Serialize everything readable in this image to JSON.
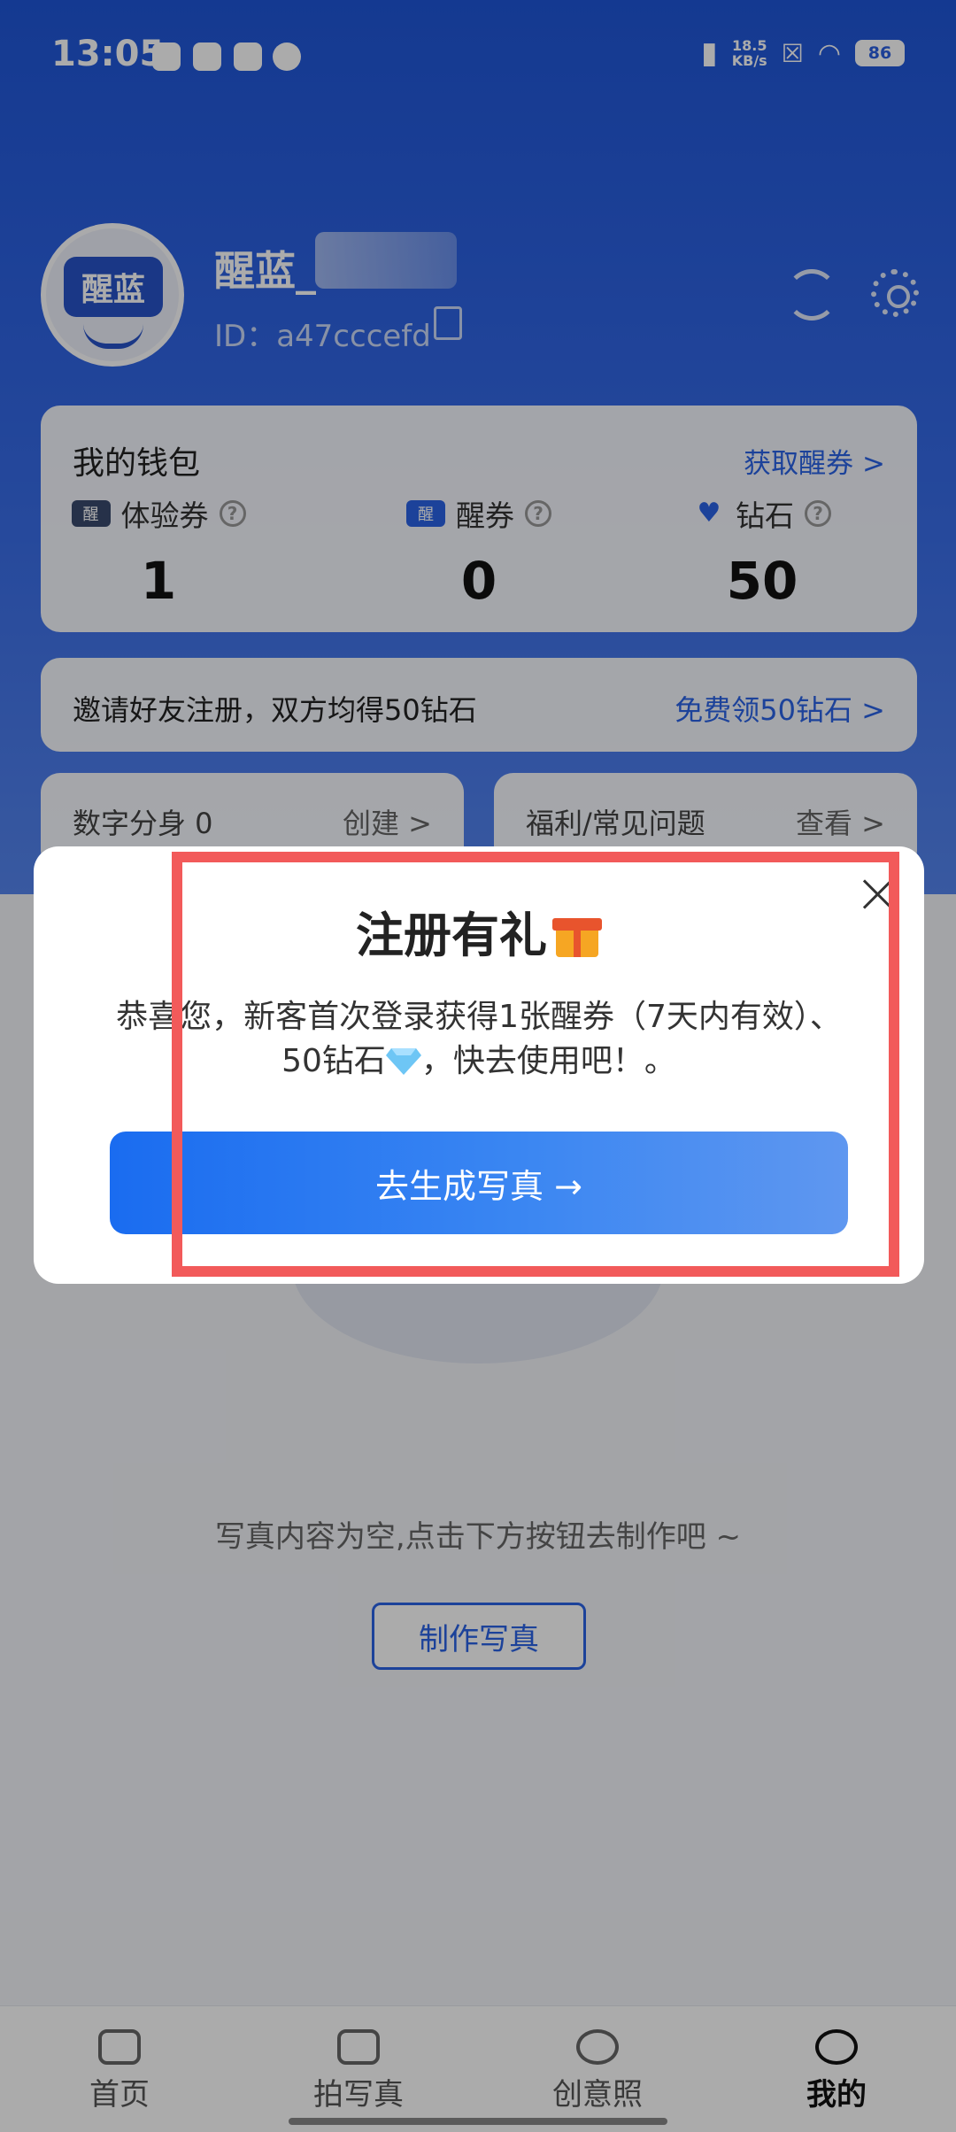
{
  "status_bar": {
    "time": "13:05",
    "net_speed_value": "18.5",
    "net_speed_unit": "KB/s",
    "battery": "86"
  },
  "profile": {
    "name": "醒蓝_",
    "avatar_text": "醒蓝",
    "user_id": "ID：a47cccefd"
  },
  "wallet": {
    "title": "我的钱包",
    "link": "获取醒券 >",
    "items": [
      {
        "label": "体验券",
        "icon_text": "醒",
        "value": "1"
      },
      {
        "label": "醒券",
        "icon_text": "醒",
        "value": "0"
      },
      {
        "label": "钻石",
        "value": "50"
      }
    ]
  },
  "invite": {
    "text": "邀请好友注册，双方均得50钻石",
    "link": "免费领50钻石 >"
  },
  "cards": {
    "avatar_clone": {
      "label": "数字分身 0",
      "action": "创建 >"
    },
    "faq": {
      "label": "福利/常见问题",
      "action": "查看 >"
    }
  },
  "empty_state": {
    "text": "写真内容为空,点击下方按钮去制作吧 ~",
    "button": "制作写真"
  },
  "tabbar": {
    "items": [
      {
        "label": "首页",
        "icon": "camera-icon"
      },
      {
        "label": "拍写真",
        "icon": "layers-icon"
      },
      {
        "label": "创意照",
        "icon": "planet-icon"
      },
      {
        "label": "我的",
        "icon": "heart-icon",
        "active": true
      }
    ]
  },
  "dialog": {
    "title": "注册有礼",
    "body_part1": "恭喜您，新客首次登录获得1张醒券（7天内有效）、50钻石",
    "body_part2": "，快去使用吧！。",
    "button": "去生成写真 →"
  },
  "colors": {
    "accent": "#2a63e6",
    "header": "#2e63e3",
    "highlight": "#f25a5a"
  }
}
